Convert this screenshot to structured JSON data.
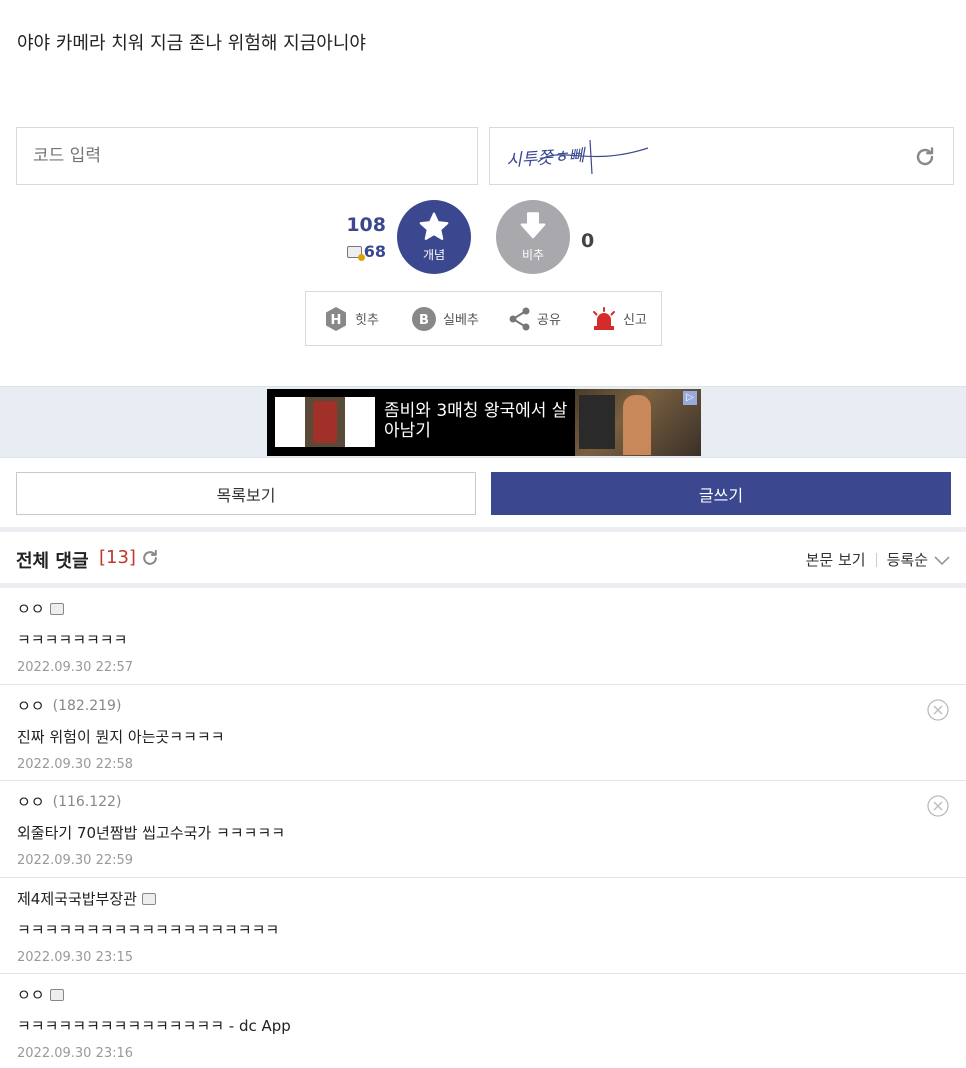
{
  "post": {
    "text": "야야 카메라 치워 지금 존나 위험해 지금아니야"
  },
  "code_entry": {
    "placeholder": "코드 입력",
    "captcha_text": "시투쫏ㅎ뻬"
  },
  "votes": {
    "up_count": "108",
    "fix_count": "68",
    "up_label": "개념",
    "down_label": "비추",
    "down_count": "0"
  },
  "actions": [
    {
      "label": "힛추"
    },
    {
      "label": "실베추"
    },
    {
      "label": "공유"
    },
    {
      "label": "신고"
    }
  ],
  "ad": {
    "text": "좀비와 3매칭 왕국에서 살아남기"
  },
  "buttons": {
    "list_label": "목록보기",
    "write_label": "글쓰기"
  },
  "comment_header": {
    "title": "전체 댓글",
    "count": "[13]",
    "view_body": "본문 보기",
    "sort": "등록순"
  },
  "comments": [
    {
      "author": "ㅇㅇ",
      "ip": "",
      "text": "ㅋㅋㅋㅋㅋㅋㅋㅋ",
      "date": "2022.09.30 22:57"
    },
    {
      "author": "ㅇㅇ",
      "ip": "(182.219)",
      "text": "진짜 위험이 뭔지 아는곳ㅋㅋㅋㅋ",
      "date": "2022.09.30 22:58"
    },
    {
      "author": "ㅇㅇ",
      "ip": "(116.122)",
      "text": "외줄타기 70년짬밥 씹고수국가 ㅋㅋㅋㅋㅋ",
      "date": "2022.09.30 22:59"
    },
    {
      "author": "제4제국국밥부장관",
      "ip": "",
      "text": "ㅋㅋㅋㅋㅋㅋㅋㅋㅋㅋㅋㅋㅋㅋㅋㅋㅋㅋㅋ",
      "date": "2022.09.30 23:15"
    },
    {
      "author": "ㅇㅇ",
      "ip": "",
      "text": "ㅋㅋㅋㅋㅋㅋㅋㅋㅋㅋㅋㅋㅋㅋㅋ - dc App",
      "date": "2022.09.30 23:16"
    }
  ],
  "colors": {
    "accent": "#3b4890",
    "downvote": "#a9a9ad",
    "count_red": "#c0392b"
  }
}
